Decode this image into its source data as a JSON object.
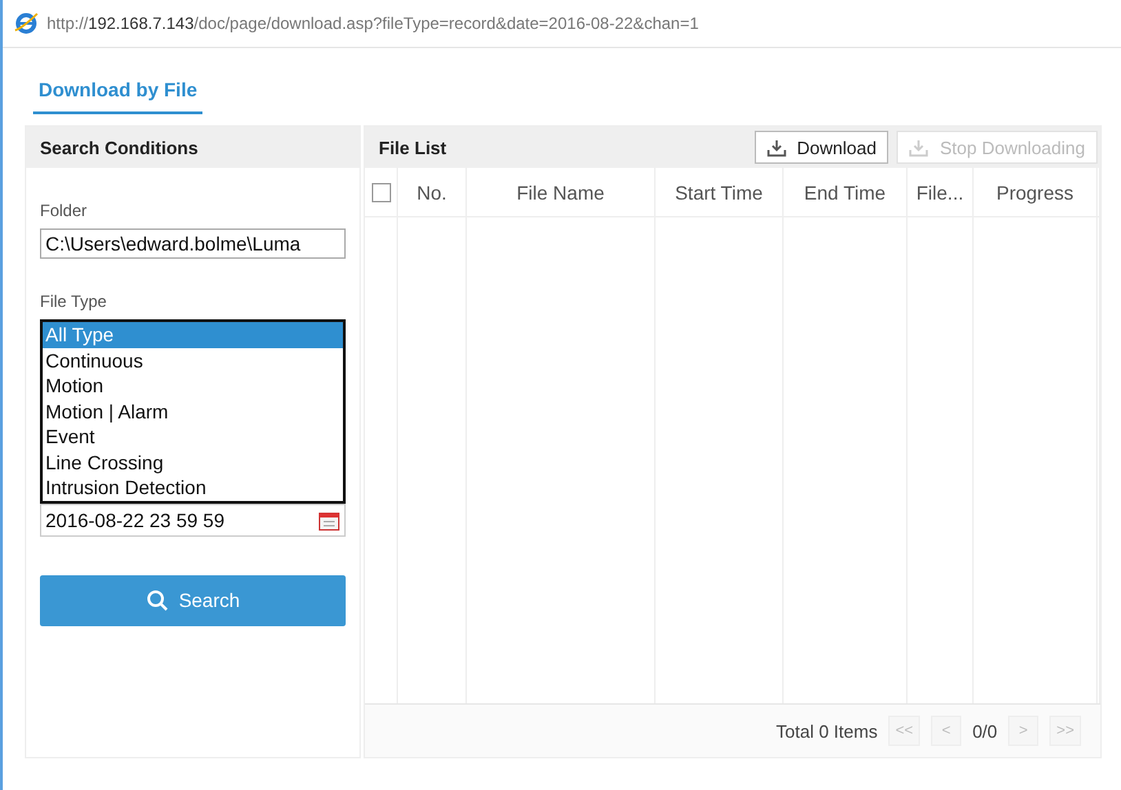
{
  "address_bar": {
    "url_prefix": "http://",
    "host": "192.168.7.143",
    "path": "/doc/page/download.asp?fileType=record&date=2016-08-22&chan=1"
  },
  "tabs": [
    {
      "label": "Download by File",
      "selected": true
    }
  ],
  "search_panel": {
    "title": "Search Conditions",
    "folder_label": "Folder",
    "folder_value": "C:\\Users\\edward.bolme\\Luma",
    "file_type_label": "File Type",
    "file_type_options": [
      {
        "label": "All Type",
        "selected": true
      },
      {
        "label": "Continuous",
        "selected": false
      },
      {
        "label": "Motion",
        "selected": false
      },
      {
        "label": "Motion | Alarm",
        "selected": false
      },
      {
        "label": "Event",
        "selected": false
      },
      {
        "label": "Line Crossing",
        "selected": false
      },
      {
        "label": "Intrusion Detection",
        "selected": false
      }
    ],
    "end_time": "2016-08-22 23 59 59",
    "search_button": "Search"
  },
  "file_list": {
    "title": "File List",
    "buttons": [
      {
        "label": "Download",
        "disabled": false
      },
      {
        "label": "Stop Downloading",
        "disabled": true
      }
    ],
    "select_all_checked": false,
    "columns": [
      "No.",
      "File Name",
      "Start Time",
      "End Time",
      "File...",
      "Progress"
    ],
    "total": "Total 0 Items",
    "pager": [
      {
        "label": "<<",
        "kind": "button"
      },
      {
        "label": "<",
        "kind": "button"
      },
      {
        "label": "0/0",
        "kind": "text"
      },
      {
        "label": ">",
        "kind": "button"
      },
      {
        "label": ">>",
        "kind": "button"
      }
    ]
  }
}
